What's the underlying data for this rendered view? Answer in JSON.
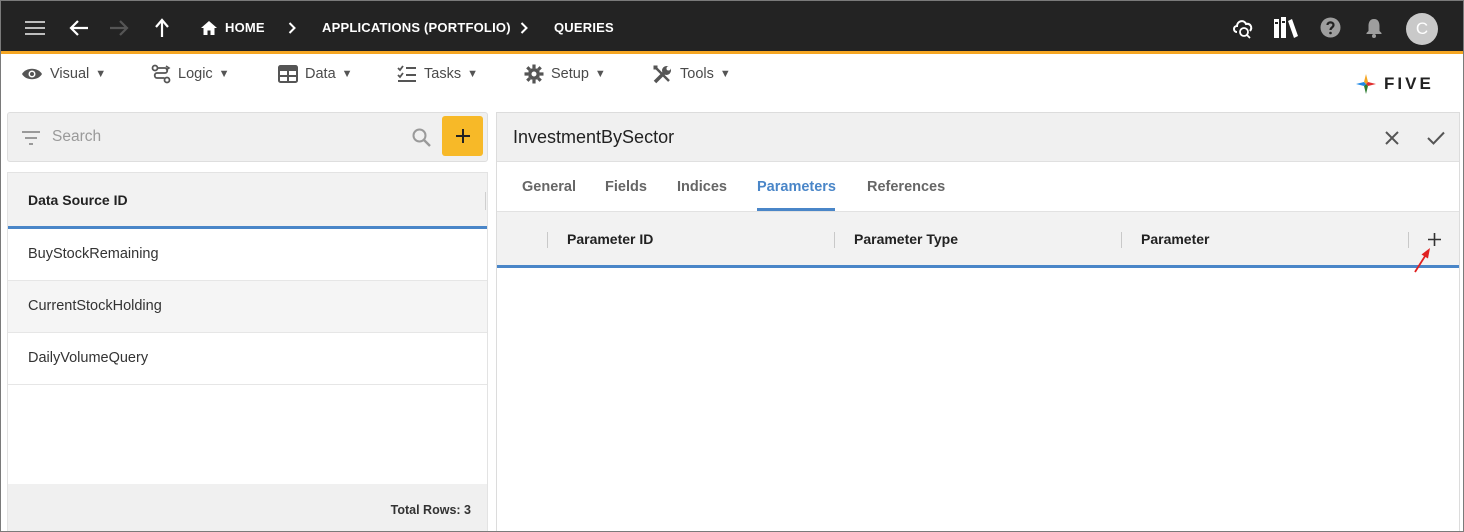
{
  "topbar": {
    "breadcrumbs": [
      {
        "label": "HOME"
      },
      {
        "label": "APPLICATIONS (PORTFOLIO)"
      },
      {
        "label": "QUERIES"
      }
    ],
    "avatar_initial": "C"
  },
  "menu": {
    "items": [
      {
        "label": "Visual"
      },
      {
        "label": "Logic"
      },
      {
        "label": "Data"
      },
      {
        "label": "Tasks"
      },
      {
        "label": "Setup"
      },
      {
        "label": "Tools"
      }
    ],
    "logo_text": "FIVE"
  },
  "left": {
    "search_placeholder": "Search",
    "column_header": "Data Source ID",
    "rows": [
      "BuyStockRemaining",
      "CurrentStockHolding",
      "DailyVolumeQuery"
    ],
    "footer": "Total Rows: 3"
  },
  "detail": {
    "title": "InvestmentBySector",
    "tabs": [
      {
        "label": "General"
      },
      {
        "label": "Fields"
      },
      {
        "label": "Indices"
      },
      {
        "label": "Parameters"
      },
      {
        "label": "References"
      }
    ],
    "active_tab": "Parameters",
    "columns": [
      "Parameter ID",
      "Parameter Type",
      "Parameter"
    ]
  },
  "colors": {
    "topbar_bg": "#232323",
    "accent_orange": "#f5a623",
    "add_button": "#f7b928",
    "accent_blue": "#4a86c8",
    "annotation_arrow": "#e02020"
  }
}
